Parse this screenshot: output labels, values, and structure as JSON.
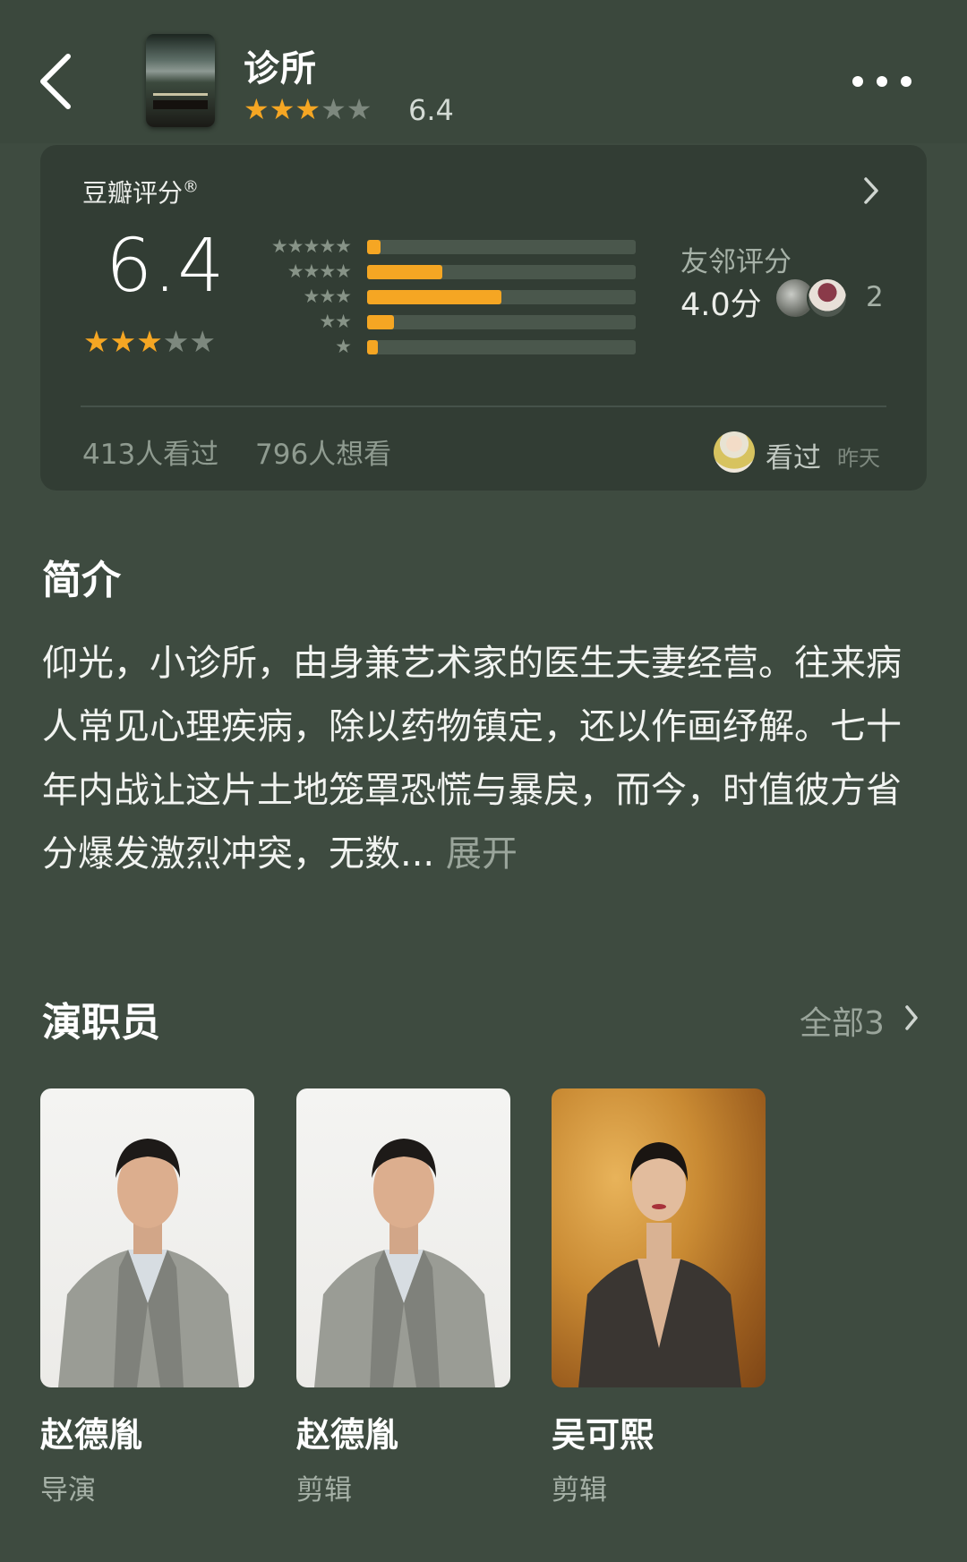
{
  "header": {
    "title": "诊所",
    "stars": "★★★★★",
    "stars_filled": 3,
    "score": "6.4"
  },
  "rating_card": {
    "title": "豆瓣评分",
    "title_mark": "®",
    "score": "6.4",
    "stars_filled": 3,
    "distribution": [
      {
        "stars": "★★★★★",
        "fraction": 0.05
      },
      {
        "stars": "★★★★",
        "fraction": 0.28
      },
      {
        "stars": "★★★",
        "fraction": 0.5
      },
      {
        "stars": "★★",
        "fraction": 0.1
      },
      {
        "stars": "★",
        "fraction": 0.04
      }
    ],
    "friends_label": "友邻评分",
    "friends_score": "4.0分",
    "friends_count": "2",
    "seen_count": "413人看过",
    "want_count": "796人想看",
    "my_status": "看过",
    "my_status_time": "昨天"
  },
  "synopsis": {
    "heading": "简介",
    "text": "仰光，小诊所，由身兼艺术家的医生夫妻经营。往来病人常见心理疾病，除以药物镇定，还以作画纾解。七十年内战让这片土地笼罩恐慌与暴戾，而今，时值彼方省分爆发激烈冲突，无数...",
    "expand_label": "展开"
  },
  "cast": {
    "heading": "演职员",
    "see_all": "全部3",
    "members": [
      {
        "name": "赵德胤",
        "role": "导演"
      },
      {
        "name": "赵德胤",
        "role": "剪辑"
      },
      {
        "name": "吴可熙",
        "role": "剪辑"
      }
    ]
  },
  "colors": {
    "background": "#3e4b40",
    "card": "#323d34",
    "accent_star": "#f5a623",
    "muted_star": "#7d887e"
  }
}
